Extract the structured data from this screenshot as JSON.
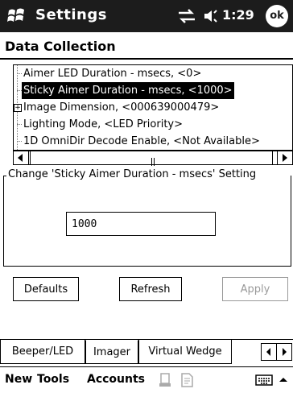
{
  "titlebar": {
    "title": "Settings",
    "time": "1:29",
    "ok_label": "ok",
    "icons": [
      "windows-start-icon",
      "connectivity-icon",
      "volume-icon"
    ]
  },
  "page": {
    "heading": "Data Collection"
  },
  "tree": {
    "items": [
      {
        "label": "Aimer LED Duration - msecs, <0>",
        "selected": false,
        "expandable": false
      },
      {
        "label": "Sticky Aimer Duration - msecs, <1000>",
        "selected": true,
        "expandable": false
      },
      {
        "label": "Image Dimension, <000639000479>",
        "selected": false,
        "expandable": true
      },
      {
        "label": "Lighting Mode, <LED Priority>",
        "selected": false,
        "expandable": false
      },
      {
        "label": "1D OmniDir Decode Enable, <Not Available>",
        "selected": false,
        "expandable": false
      }
    ]
  },
  "setting": {
    "group_label": "Change 'Sticky Aimer Duration - msecs' Setting",
    "value": "1000"
  },
  "buttons": {
    "defaults_label": "Defaults",
    "refresh_label": "Refresh",
    "apply_label": "Apply"
  },
  "tabs": {
    "items": [
      {
        "label": "Beeper/LED",
        "active": false
      },
      {
        "label": "Imager",
        "active": true
      },
      {
        "label": "Virtual Wedge",
        "active": false
      }
    ]
  },
  "menubar": {
    "new_label": "New",
    "tools_label": "Tools",
    "accounts_label": "Accounts",
    "icons": [
      "sync-icon",
      "document-icon",
      "keyboard-icon",
      "up-arrow-icon"
    ]
  },
  "colors": {
    "titlebar_bg": "#1c1c1c",
    "selection_bg": "#000000",
    "disabled_text": "#9a9a9a"
  }
}
